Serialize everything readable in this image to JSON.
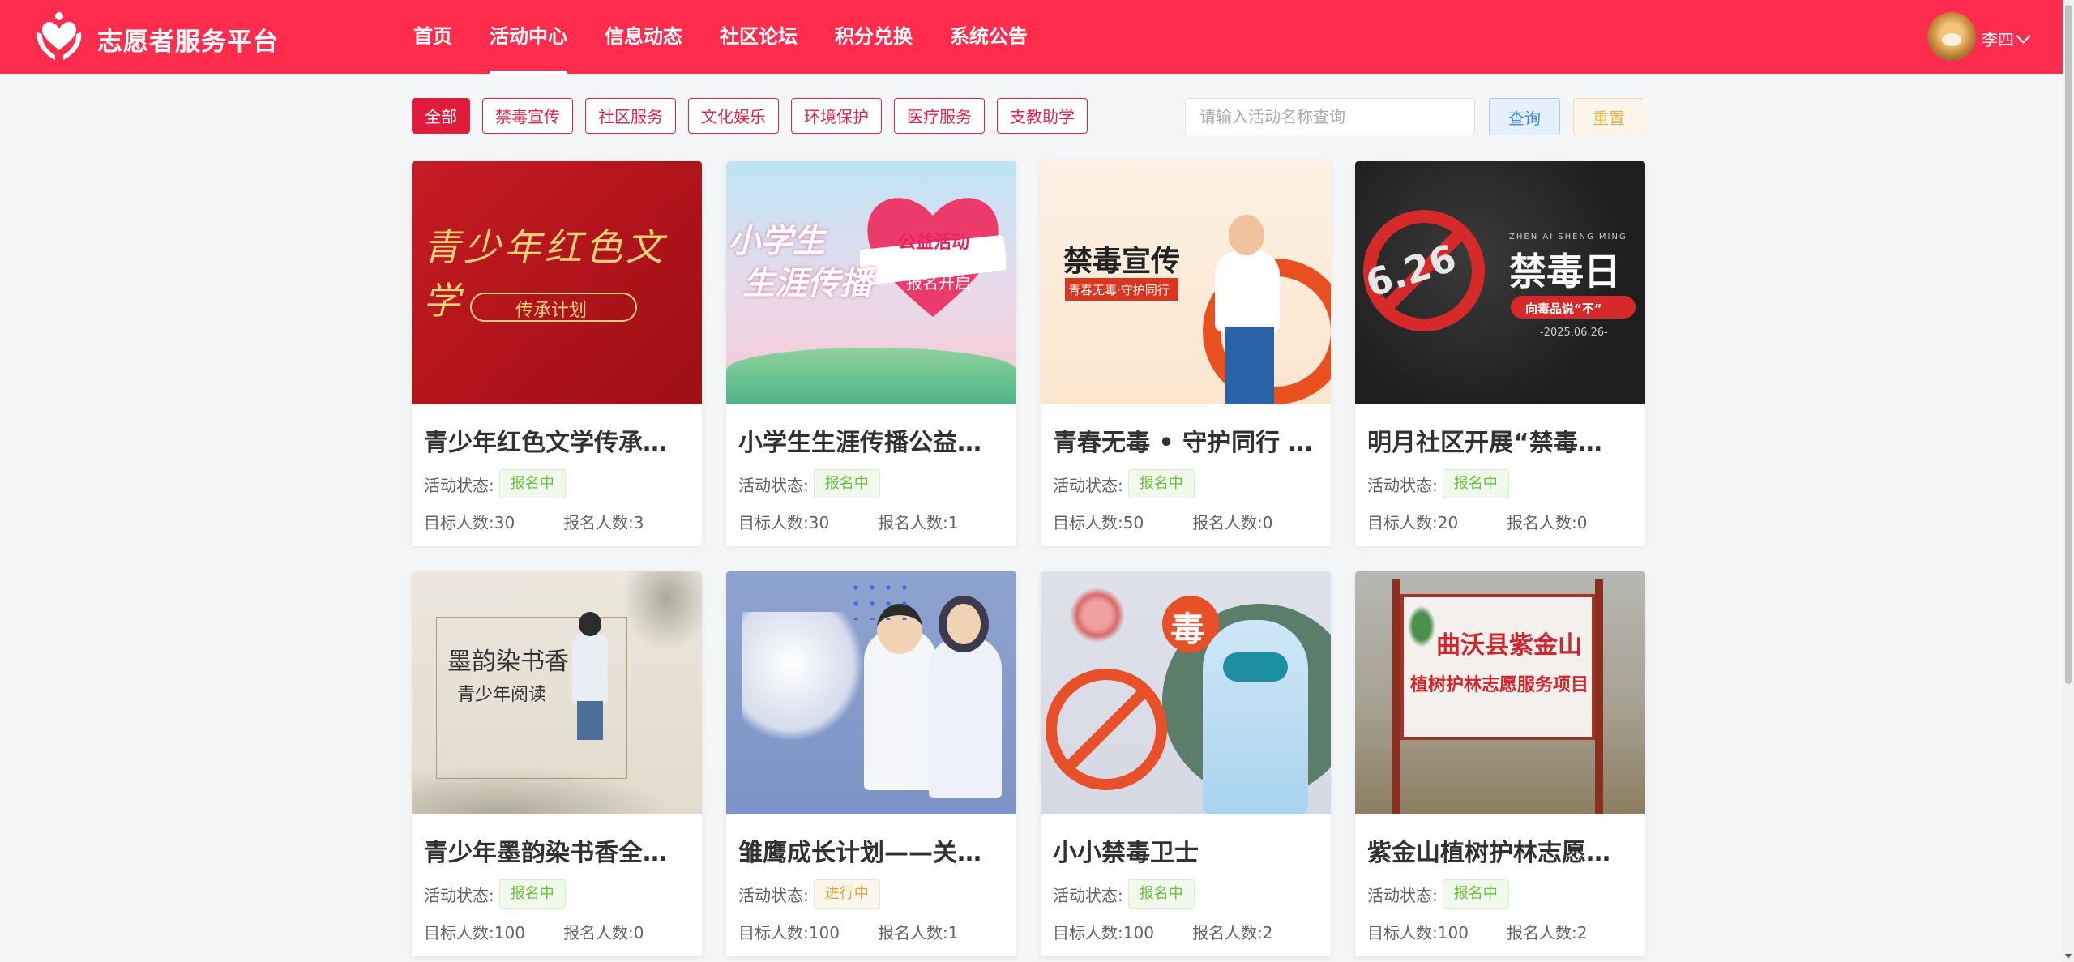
{
  "header": {
    "brand": "志愿者服务平台",
    "nav": [
      "首页",
      "活动中心",
      "信息动态",
      "社区论坛",
      "积分兑换",
      "系统公告"
    ],
    "active_nav": 1,
    "user_name": "李四"
  },
  "filters": {
    "categories": [
      "全部",
      "禁毒宣传",
      "社区服务",
      "文化娱乐",
      "环境保护",
      "医疗服务",
      "支教助学"
    ],
    "active": 0,
    "search_placeholder": "请输入活动名称查询",
    "search_value": "",
    "query_label": "查询",
    "reset_label": "重置"
  },
  "labels": {
    "status_label": "活动状态:",
    "target_label": "目标人数:",
    "signed_label": "报名人数:"
  },
  "cards": [
    {
      "title": "青少年红色文学传承…",
      "status": "报名中",
      "status_color": "green",
      "target": "30",
      "signed": "3",
      "img_text": [
        "青少年红色文学",
        "传承计划"
      ]
    },
    {
      "title": "小学生生涯传播公益…",
      "status": "报名中",
      "status_color": "green",
      "target": "30",
      "signed": "1",
      "img_text": [
        "小学生",
        "生涯传播",
        "公益活动",
        "报名开启"
      ]
    },
    {
      "title": "青春无毒 • 守护同行 …",
      "status": "报名中",
      "status_color": "green",
      "target": "50",
      "signed": "0",
      "img_text": [
        "禁毒宣传",
        "青春无毒·守护同行"
      ]
    },
    {
      "title": "明月社区开展“禁毒…",
      "status": "报名中",
      "status_color": "green",
      "target": "20",
      "signed": "0",
      "img_text": [
        "ZHEN AI SHENG MING",
        "禁毒日",
        "向毒品说“不”",
        "-2025.06.26-",
        "6.26"
      ]
    },
    {
      "title": "青少年墨韵染书香全…",
      "status": "报名中",
      "status_color": "green",
      "target": "100",
      "signed": "0",
      "img_text": [
        "墨韵染书香",
        "青少年阅读"
      ]
    },
    {
      "title": "雏鹰成长计划——关爱…",
      "status": "进行中",
      "status_color": "yellow",
      "target": "100",
      "signed": "1",
      "img_text": []
    },
    {
      "title": "小小禁毒卫士",
      "status": "报名中",
      "status_color": "green",
      "target": "100",
      "signed": "2",
      "img_text": [
        "毒"
      ]
    },
    {
      "title": "紫金山植树护林志愿…",
      "status": "报名中",
      "status_color": "green",
      "target": "100",
      "signed": "2",
      "img_text": [
        "曲沃县紫金山",
        "植树护林志愿服务项目"
      ]
    }
  ],
  "icons": {
    "logo": "heart-hands-icon",
    "user_menu": "chevron-down-icon"
  },
  "colors": {
    "brand_red": "#ff2c4e",
    "tag_red": "#e22544",
    "status_green": "#67c23a",
    "status_yellow": "#e6a23c"
  }
}
